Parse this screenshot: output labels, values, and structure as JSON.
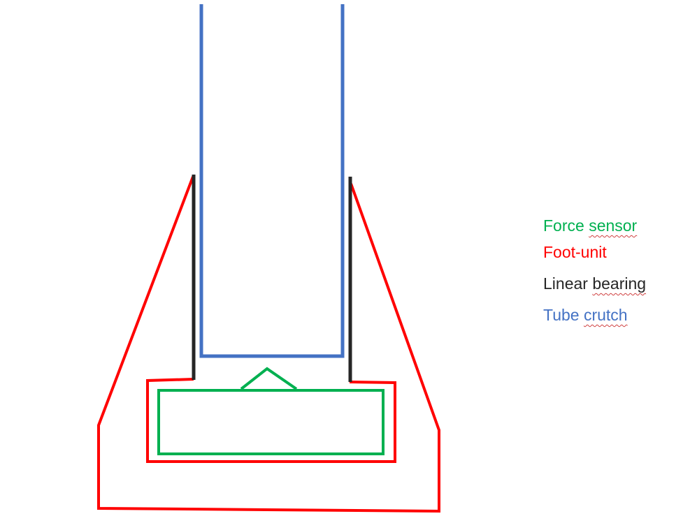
{
  "colors": {
    "force_sensor": "#00b050",
    "foot_unit": "#ff0000",
    "linear_bearing": "#262626",
    "tube_crutch": "#4472c4"
  },
  "legend": {
    "items": [
      {
        "key": "force_sensor",
        "word1": "Force ",
        "word2": "sensor"
      },
      {
        "key": "foot_unit",
        "word1": "Foot-unit",
        "word2": ""
      },
      {
        "key": "linear_bearing",
        "word1": "Linear ",
        "word2": "bearing"
      },
      {
        "key": "tube_crutch",
        "word1": "Tube ",
        "word2": "crutch"
      }
    ]
  }
}
